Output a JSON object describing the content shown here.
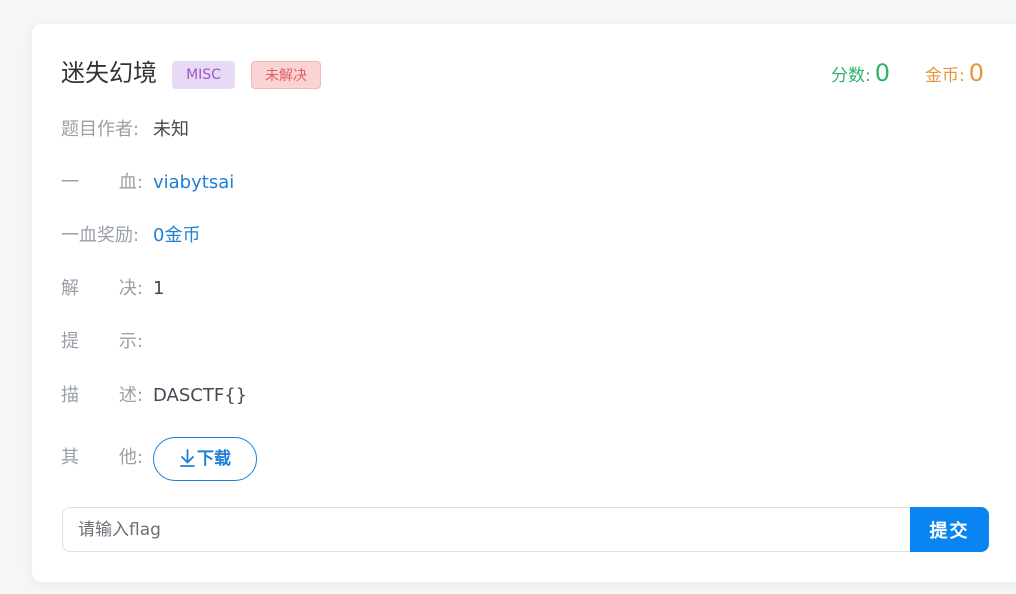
{
  "challenge": {
    "title": "迷失幻境",
    "category_tag": "MISC",
    "status_tag": "未解决",
    "score_label": "分数:",
    "score_value": "0",
    "coins_label": "金币:",
    "coins_value": "0"
  },
  "details": {
    "author_label": "题目作者:",
    "author_value": "未知",
    "first_blood_label_a": "一",
    "first_blood_label_b": "血:",
    "first_blood_value": "viabytsai",
    "first_blood_reward_label": "一血奖励:",
    "first_blood_reward_value": "0金币",
    "solves_label_a": "解",
    "solves_label_b": "决:",
    "solves_value": "1",
    "hint_label_a": "提",
    "hint_label_b": "示:",
    "hint_value": "",
    "description_label_a": "描",
    "description_label_b": "述:",
    "description_value": "DASCTF{}",
    "other_label_a": "其",
    "other_label_b": "他:",
    "download_label": "下载"
  },
  "submit": {
    "placeholder": "请输入flag",
    "button_label": "提交"
  },
  "colors": {
    "accent": "#0a84f0",
    "link": "#1e7fd6",
    "score": "#2fb36b",
    "coins": "#e8963b"
  },
  "icons": {
    "download": "download-arrow-icon"
  }
}
